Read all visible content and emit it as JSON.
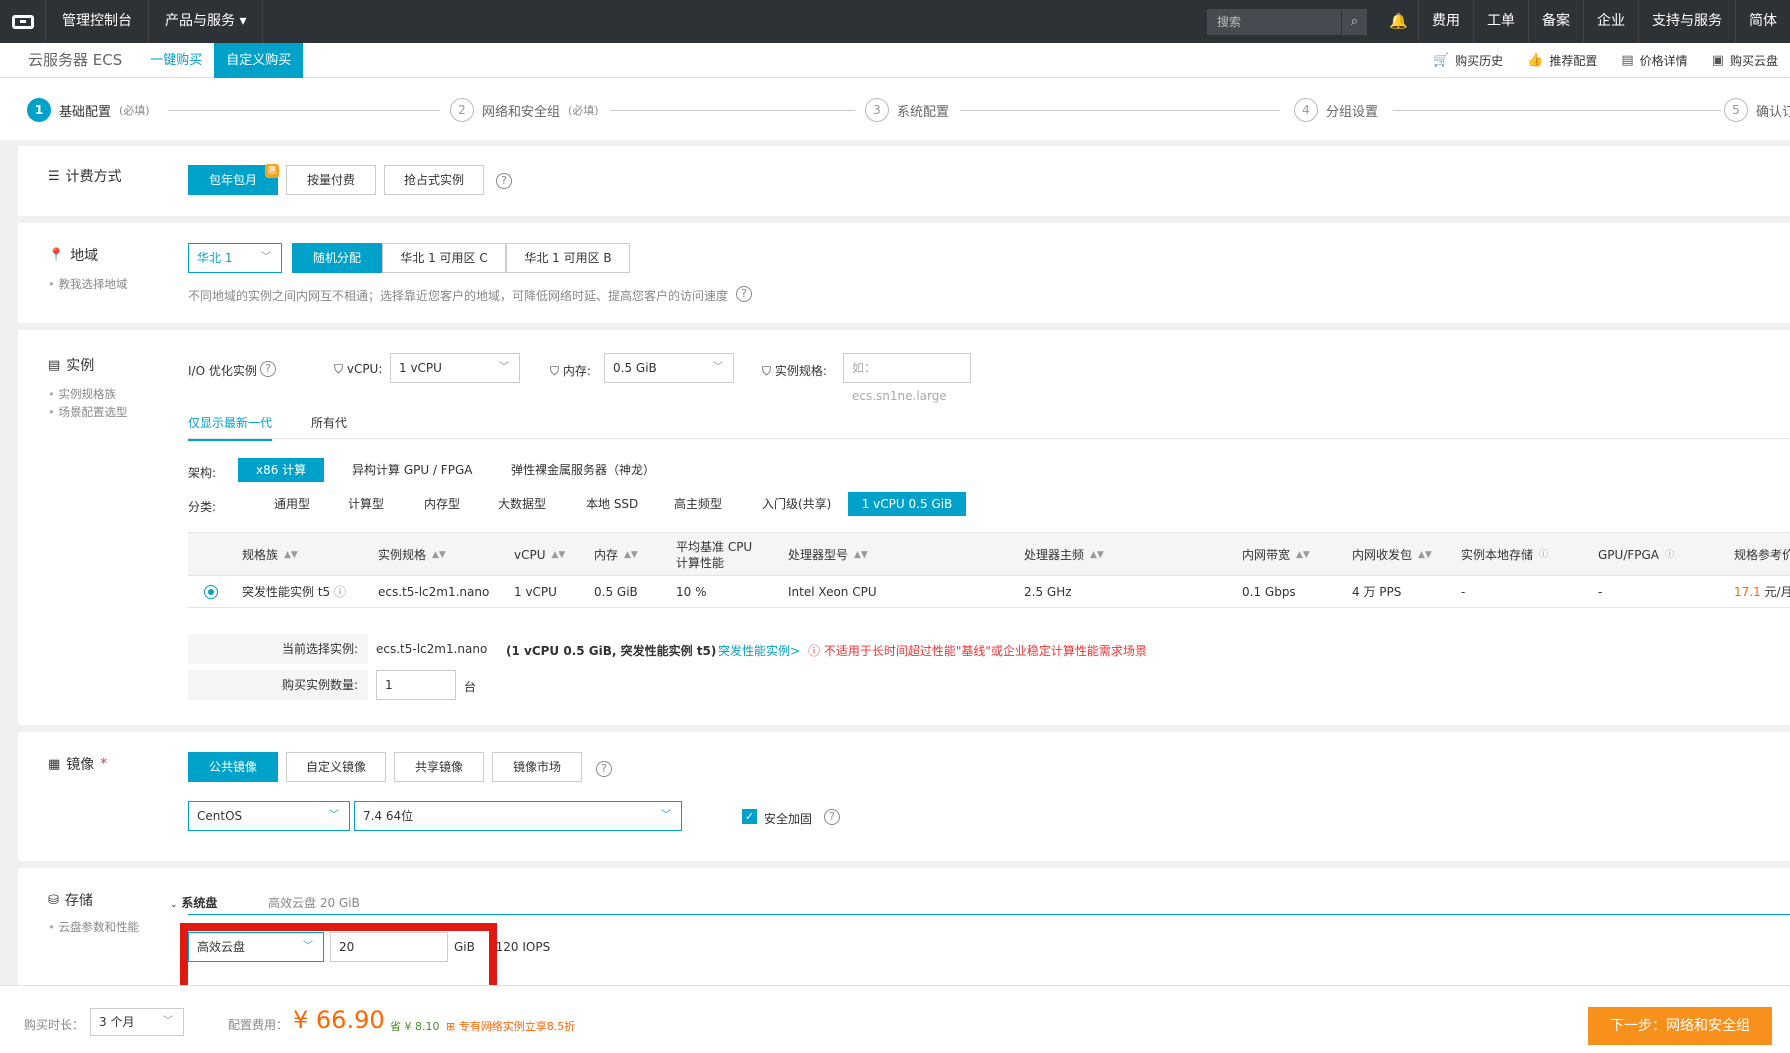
{
  "topnav": {
    "console": "管理控制台",
    "products": "产品与服务",
    "search_placeholder": "搜索",
    "links": [
      "费用",
      "工单",
      "备案",
      "企业",
      "支持与服务",
      "简体"
    ]
  },
  "subhead": {
    "title": "云服务器 ECS",
    "tabs": [
      "一键购买",
      "自定义购买"
    ],
    "tools": [
      "购买历史",
      "推荐配置",
      "价格详情",
      "购买云盘"
    ]
  },
  "steps": [
    {
      "num": "1",
      "label": "基础配置",
      "req": "(必填)"
    },
    {
      "num": "2",
      "label": "网络和安全组",
      "req": "(必填)"
    },
    {
      "num": "3",
      "label": "系统配置",
      "req": ""
    },
    {
      "num": "4",
      "label": "分组设置",
      "req": ""
    },
    {
      "num": "5",
      "label": "确认订单",
      "req": ""
    }
  ],
  "billing": {
    "title": "计费方式",
    "options": [
      "包年包月",
      "按量付费",
      "抢占式实例"
    ],
    "badge": "惠"
  },
  "region": {
    "title": "地域",
    "sub": "教我选择地域",
    "region_select": "华北 1",
    "zones": [
      "随机分配",
      "华北 1 可用区 C",
      "华北 1 可用区 B"
    ],
    "note": "不同地域的实例之间内网互不相通；选择靠近您客户的地域，可降低网络时延、提高您客户的访问速度"
  },
  "instance": {
    "title": "实例",
    "subs": [
      "实例规格族",
      "场景配置选型"
    ],
    "io_label": "I/O 优化实例",
    "vcpu_label": "vCPU:",
    "vcpu_value": "1 vCPU",
    "mem_label": "内存:",
    "mem_value": "0.5 GiB",
    "spec_label": "实例规格:",
    "spec_placeholder": "如：ecs.sn1ne.large",
    "gen_tabs": [
      "仅显示最新一代",
      "所有代"
    ],
    "arch_label": "架构:",
    "arch": [
      "x86 计算",
      "异构计算 GPU / FPGA",
      "弹性裸金属服务器（神龙）"
    ],
    "cat_label": "分类:",
    "categories": [
      "通用型",
      "计算型",
      "内存型",
      "大数据型",
      "本地 SSD",
      "高主频型",
      "入门级(共享)",
      "1 vCPU 0.5 GiB"
    ],
    "columns": [
      "规格族",
      "实例规格",
      "vCPU",
      "内存",
      "平均基准 CPU 计算性能",
      "处理器型号",
      "处理器主频",
      "内网带宽",
      "内网收发包",
      "实例本地存储",
      "GPU/FPGA",
      "规格参考价格"
    ],
    "row": {
      "family": "突发性能实例 t5",
      "spec": "ecs.t5-lc2m1.nano",
      "vcpu": "1 vCPU",
      "mem": "0.5 GiB",
      "cpu_perf": "10 %",
      "cpu_model": "Intel Xeon CPU",
      "freq": "2.5 GHz",
      "bandwidth": "0.1 Gbps",
      "pps": "4 万 PPS",
      "storage": "-",
      "gpu": "-",
      "price_num": "17.1",
      "price_unit": " 元/月"
    },
    "current_label": "当前选择实例:",
    "current_value": "ecs.t5-lc2m1.nano",
    "current_desc": "(1 vCPU 0.5 GiB, 突发性能实例 t5)",
    "burst_link": "突发性能实例>",
    "warning": "不适用于长时间超过性能\"基线\"或企业稳定计算性能需求场景",
    "qty_label": "购买实例数量:",
    "qty_value": "1",
    "qty_unit": "台"
  },
  "image": {
    "title": "镜像",
    "star": "*",
    "types": [
      "公共镜像",
      "自定义镜像",
      "共享镜像",
      "镜像市场"
    ],
    "os": "CentOS",
    "version": "7.4 64位",
    "security_label": "安全加固"
  },
  "storage": {
    "title": "存储",
    "sub": "云盘参数和性能",
    "sys_disk_label": "系统盘",
    "sys_disk_summary": "高效云盘   20 GiB",
    "disk_type": "高效云盘",
    "disk_size": "20",
    "size_unit": "GiB",
    "iops": "1120 IOPS"
  },
  "footer": {
    "duration_label": "购买时长：",
    "duration_value": "3 个月",
    "fee_label": "配置费用：",
    "price": "¥ 66.90",
    "save_label": "省 ¥",
    "save_value": "8.10",
    "promo": "专有网络实例立享8.5折",
    "next_button": "下一步：网络和安全组"
  }
}
